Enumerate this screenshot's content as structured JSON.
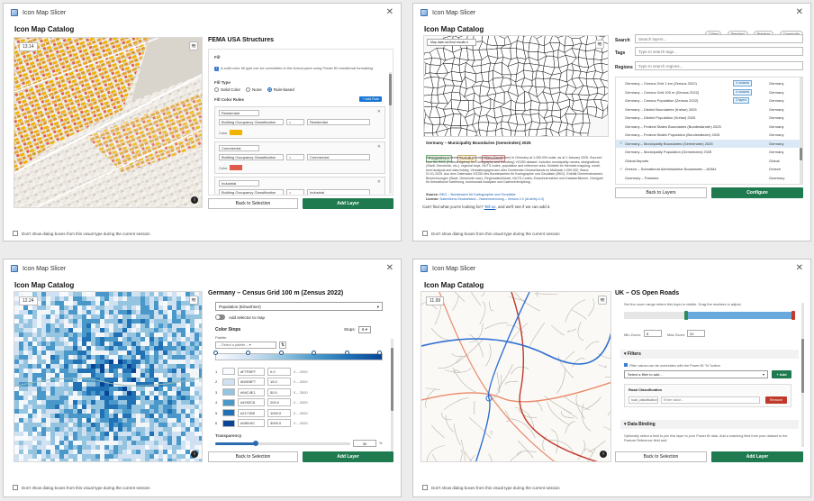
{
  "common": {
    "window_title": "Icon Map Slicer",
    "heading": "Icon Map Catalog",
    "back_label": "Back to Selection",
    "add_label": "Add Layer",
    "footer_text": "Don't show dialog boxes from this visual type during the current session"
  },
  "w1": {
    "zoom": "13.14",
    "title": "FEMA USA Structures",
    "section_fill": "Fill",
    "note": "A solid color fill type can be overridden in the format pane using Power BI conditional formatting.",
    "fill_type_label": "Fill Type",
    "fill_options": [
      "Solid Color",
      "None",
      "Rule-based"
    ],
    "rules_label": "Fill Color Rules",
    "add_rule_label": "+ Add Rule",
    "rules": [
      {
        "name": "Residential",
        "field": "Building Occupancy Classification",
        "op": "=",
        "value": "Residential",
        "color_label": "Color",
        "color": "#f0b400"
      },
      {
        "name": "Commercial",
        "field": "Building Occupancy Classification",
        "op": "=",
        "value": "Commercial",
        "color_label": "Color",
        "color": "#e05a4a"
      },
      {
        "name": "Industrial",
        "field": "Building Occupancy Classification",
        "op": "=",
        "value": "Industrial",
        "color_label": "Color",
        "color": "#e87a3a"
      }
    ]
  },
  "w2": {
    "badges": [
      "2 New",
      "Standard",
      "Premium",
      "Community"
    ],
    "map_dropdown": "Map data not final results",
    "layer_title": "Germany – Municipality Boundaries (Gemeinden) 2025",
    "tags": [
      "Polygon/Lines",
      "Germany",
      "Government"
    ],
    "description": "Administrative boundaries of all municipalities (Gemeinden) in Germany at 1:250,000 scale, as at 1 January 2025. Sourced from the BKG (Federal Agency for Cartography and Geodesy) VG250 dataset. Includes municipality names, designations (Stadt, Gemeinde, etc.), regional keys, NUTS codes, population and reference area. Suitable for thematic mapping, small-level analysis and data linking. Verwaltungsgrenzen aller Gemeinden Deutschlands im Maßstab 1:250.000, Stand 01.01.2025. Aus dem Datensatz VG250 des Bundesamtes für Kartographie und Geodäsie (BKG). Enthält Gemeindenamen, Bezeichnungen (Stadt, Gemeinde usw.), Regionalschlüssel, NUTS-Codes, Einwohnerzahlen und Katasterflächen. Geeignet für thematische Kartierung, kommunale Analysen und Datenverknüpfung.",
    "source_label": "Source:",
    "source_value": "BKG – Bundesamt für Kartographie und Geodäsie",
    "license_label": "License:",
    "license_value": "Datenlizenz Deutschland – Namensnennung – Version 2.0 (dl-de/by-2-0)",
    "search_label": "Search",
    "search_placeholder": "Search layers...",
    "tags_label": "Tags",
    "tags_placeholder": "Type to search tags...",
    "regions_label": "Regions",
    "regions_placeholder": "Type to search regions...",
    "list": [
      {
        "name": "Germany – Census Grid 1 km (Zensus 2022)",
        "badge": "4 variants",
        "region": "Germany",
        "checked": false,
        "selected": false
      },
      {
        "name": "Germany – Census Grid 100 m (Zensus 2022)",
        "badge": "4 variants",
        "region": "Germany",
        "checked": false,
        "selected": false
      },
      {
        "name": "Germany – Census Population (Zensus 2022)",
        "badge": "3 layers",
        "region": "Germany",
        "checked": false,
        "selected": false
      },
      {
        "name": "Germany – District Boundaries (Kreise) 2025",
        "badge": "",
        "region": "Germany",
        "checked": false,
        "selected": false
      },
      {
        "name": "Germany – District Population (Kreise) 2025",
        "badge": "",
        "region": "Germany",
        "checked": false,
        "selected": false
      },
      {
        "name": "Germany – Federal States Boundaries (Bundesländer) 2025",
        "badge": "",
        "region": "Germany",
        "checked": false,
        "selected": false
      },
      {
        "name": "Germany – Federal States Population (Bundesländer) 2025",
        "badge": "",
        "region": "Germany",
        "checked": false,
        "selected": false
      },
      {
        "name": "Germany – Municipality Boundaries (Gemeinden) 2025",
        "badge": "",
        "region": "Germany",
        "checked": true,
        "selected": true
      },
      {
        "name": "Germany – Municipality Population (Gemeinden) 2025",
        "badge": "",
        "region": "Germany",
        "checked": false,
        "selected": false
      },
      {
        "name": "Global Airports",
        "badge": "",
        "region": "Global",
        "checked": false,
        "selected": false
      },
      {
        "name": "Greece – Subnational Administrative Boundaries – ADM4",
        "badge": "",
        "region": "Greece",
        "checked": true,
        "selected": false
      },
      {
        "name": "Guernsey – Parishes",
        "badge": "",
        "region": "Guernsey",
        "checked": false,
        "selected": false
      }
    ],
    "back_layers": "Back to Layers",
    "configure": "Configure",
    "cant_find": "Can't find what you're looking for?",
    "tell_us": "Tell us",
    "cant_find_tail": ", and we'll see if we can add it."
  },
  "w3": {
    "zoom": "12.24",
    "title": "Germany – Census Grid 100 m (Zensus 2022)",
    "variable": "Population (Einwohner)",
    "toggle_label": "Add selector to map",
    "color_stops_label": "Color Stops",
    "stops_label": "Stops:",
    "stops_value": "6",
    "palette_label": "Palette",
    "palette_placeholder": "– Select a palette –",
    "stops": [
      {
        "idx": "1",
        "hex": "#F7FBFF",
        "value": "0.0",
        "range": "0 – 3000",
        "color": "#f7fbff"
      },
      {
        "idx": "2",
        "hex": "#D0E8F7",
        "value": "15.0",
        "range": "0 – 3000",
        "color": "#d0e1f2"
      },
      {
        "idx": "3",
        "hex": "#94C4E1",
        "value": "50.0",
        "range": "0 – 3000",
        "color": "#94c4df"
      },
      {
        "idx": "4",
        "hex": "#4292C6",
        "value": "200.0",
        "range": "0 – 3000",
        "color": "#4a98c9"
      },
      {
        "idx": "5",
        "hex": "#2171B5",
        "value": "1000.0",
        "range": "0 – 3000",
        "color": "#2171b5"
      },
      {
        "idx": "6",
        "hex": "#08519C",
        "value": "3000.0",
        "range": "0 – 3000",
        "color": "#084594"
      }
    ],
    "transparency_label": "Transparency",
    "transparency_value": "30",
    "transparency_level": 0.3,
    "percent": "%"
  },
  "w4": {
    "zoom": "11.99",
    "title": "UK – OS Open Roads",
    "zoom_hint": "Set the zoom range where this layer is visible. Drag the markers to adjust.",
    "min_zoom_label": "Min Zoom:",
    "min_zoom": "8",
    "max_zoom_label": "Max Zoom:",
    "max_zoom": "22",
    "filters_label": "Filters",
    "filters_note": "Filter values can be overridden with the Power BI \"fx\" button",
    "filter_placeholder": "Select a filter to add...",
    "add_filter": "+ Add",
    "road_class_label": "Road Classification",
    "road_class_field": "road_classification",
    "road_class_placeholder": "Enter value...",
    "remove_label": "Remove",
    "data_binding_label": "Data Binding",
    "binding_note": "Optionally select a field to join this layer to your Power BI data. Add a matching field from your dataset to the Feature Reference field well."
  }
}
